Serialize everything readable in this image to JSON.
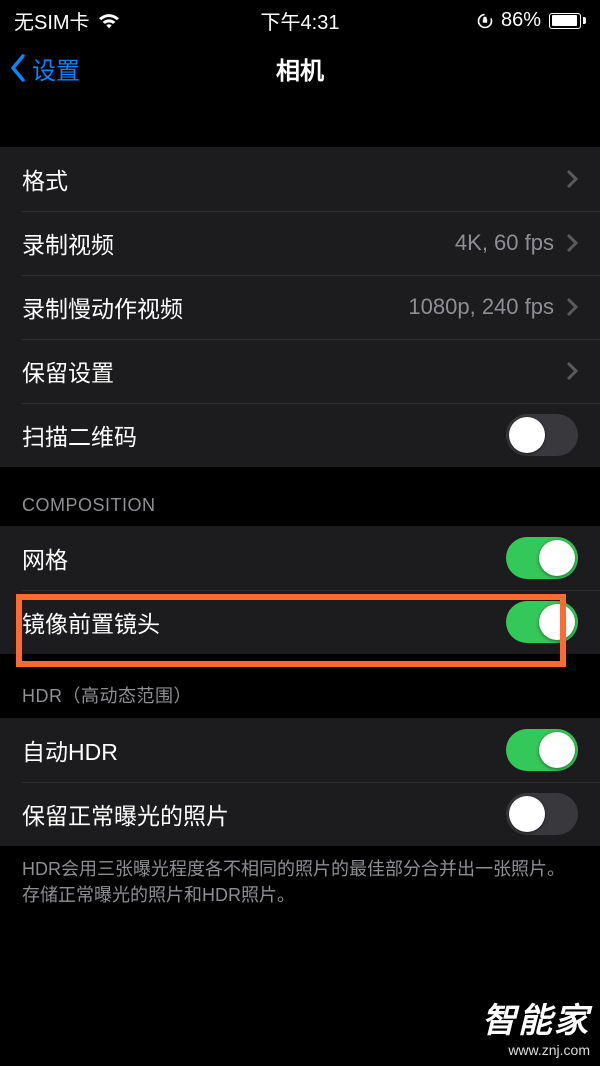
{
  "status": {
    "sim": "无SIM卡",
    "time": "下午4:31",
    "battery_pct": "86%"
  },
  "nav": {
    "back": "设置",
    "title": "相机"
  },
  "rows": {
    "formats": "格式",
    "record_video": {
      "label": "录制视频",
      "value": "4K, 60 fps"
    },
    "record_slomo": {
      "label": "录制慢动作视频",
      "value": "1080p, 240 fps"
    },
    "preserve": "保留设置",
    "scan_qr": "扫描二维码",
    "grid": "网格",
    "mirror_front": "镜像前置镜头",
    "auto_hdr": "自动HDR",
    "keep_normal": "保留正常曝光的照片"
  },
  "sections": {
    "composition": "COMPOSITION",
    "hdr": "HDR（高动态范围）",
    "hdr_footer": "HDR会用三张曝光程度各不相同的照片的最佳部分合并出一张照片。存储正常曝光的照片和HDR照片。"
  },
  "toggles": {
    "scan_qr": false,
    "grid": true,
    "mirror_front": true,
    "auto_hdr": true,
    "keep_normal": false
  },
  "watermark": {
    "brand": "智能家",
    "url": "www.znj.com"
  }
}
